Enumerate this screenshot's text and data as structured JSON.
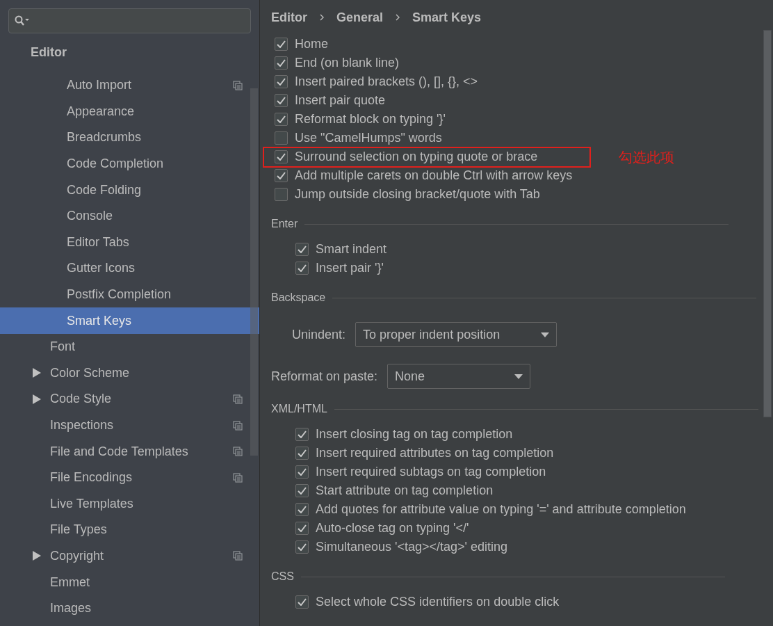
{
  "sidebar": {
    "header": "Editor",
    "items": [
      {
        "kind": "page",
        "label": "Auto Import",
        "selected": false,
        "project_level": true,
        "sub": true
      },
      {
        "kind": "page",
        "label": "Appearance",
        "selected": false,
        "project_level": false,
        "sub": true
      },
      {
        "kind": "page",
        "label": "Breadcrumbs",
        "selected": false,
        "project_level": false,
        "sub": true
      },
      {
        "kind": "page",
        "label": "Code Completion",
        "selected": false,
        "project_level": false,
        "sub": true
      },
      {
        "kind": "page",
        "label": "Code Folding",
        "selected": false,
        "project_level": false,
        "sub": true
      },
      {
        "kind": "page",
        "label": "Console",
        "selected": false,
        "project_level": false,
        "sub": true
      },
      {
        "kind": "page",
        "label": "Editor Tabs",
        "selected": false,
        "project_level": false,
        "sub": true
      },
      {
        "kind": "page",
        "label": "Gutter Icons",
        "selected": false,
        "project_level": false,
        "sub": true
      },
      {
        "kind": "page",
        "label": "Postfix Completion",
        "selected": false,
        "project_level": false,
        "sub": true
      },
      {
        "kind": "page",
        "label": "Smart Keys",
        "selected": true,
        "project_level": false,
        "sub": true
      },
      {
        "kind": "page",
        "label": "Font",
        "selected": false,
        "project_level": false,
        "sub": false
      },
      {
        "kind": "group",
        "label": "Color Scheme",
        "selected": false,
        "expanded": false,
        "project_level": false,
        "sub": false
      },
      {
        "kind": "group",
        "label": "Code Style",
        "selected": false,
        "expanded": false,
        "project_level": true,
        "sub": false
      },
      {
        "kind": "page",
        "label": "Inspections",
        "selected": false,
        "project_level": true,
        "sub": false
      },
      {
        "kind": "page",
        "label": "File and Code Templates",
        "selected": false,
        "project_level": true,
        "sub": false
      },
      {
        "kind": "page",
        "label": "File Encodings",
        "selected": false,
        "project_level": true,
        "sub": false
      },
      {
        "kind": "page",
        "label": "Live Templates",
        "selected": false,
        "project_level": false,
        "sub": false
      },
      {
        "kind": "page",
        "label": "File Types",
        "selected": false,
        "project_level": false,
        "sub": false
      },
      {
        "kind": "group",
        "label": "Copyright",
        "selected": false,
        "expanded": false,
        "project_level": true,
        "sub": false
      },
      {
        "kind": "page",
        "label": "Emmet",
        "selected": false,
        "project_level": false,
        "sub": false
      },
      {
        "kind": "page",
        "label": "Images",
        "selected": false,
        "project_level": false,
        "sub": false
      }
    ]
  },
  "breadcrumb": [
    "Editor",
    "General",
    "Smart Keys"
  ],
  "content": [
    {
      "kind": "group",
      "items": [
        {
          "kind": "check",
          "label": "Home",
          "checked": true,
          "highlighted": false
        },
        {
          "kind": "check",
          "label": "End (on blank line)",
          "checked": true,
          "highlighted": false
        },
        {
          "kind": "check",
          "label": "Insert paired brackets (), [], {}, <>",
          "checked": true,
          "highlighted": false
        },
        {
          "kind": "check",
          "label": "Insert pair quote",
          "checked": true,
          "highlighted": false
        },
        {
          "kind": "check",
          "label": "Reformat block on typing '}'",
          "checked": true,
          "highlighted": false
        },
        {
          "kind": "check",
          "label": "Use \"CamelHumps\" words",
          "checked": false,
          "highlighted": false
        },
        {
          "kind": "check",
          "label": "Surround selection on typing quote or brace",
          "checked": true,
          "highlighted": true,
          "annotation": "勾选此项"
        },
        {
          "kind": "check",
          "label": "Add multiple carets on double Ctrl with arrow keys",
          "checked": true,
          "highlighted": false
        },
        {
          "kind": "check",
          "label": "Jump outside closing bracket/quote with Tab",
          "checked": false,
          "highlighted": false
        }
      ]
    },
    {
      "kind": "section",
      "title": "Enter",
      "items": [
        {
          "kind": "check",
          "label": "Smart indent",
          "checked": true,
          "highlighted": false
        },
        {
          "kind": "check",
          "label": "Insert pair '}'",
          "checked": true,
          "highlighted": false
        }
      ]
    },
    {
      "kind": "section",
      "title": "Backspace",
      "items": [
        {
          "kind": "dropdown",
          "label": "Unindent:",
          "value": "To proper indent position"
        }
      ]
    },
    {
      "kind": "dropdown",
      "label": "Reformat on paste:",
      "value": "None"
    },
    {
      "kind": "section",
      "title": "XML/HTML",
      "items": [
        {
          "kind": "check",
          "label": "Insert closing tag on tag completion",
          "checked": true,
          "highlighted": false
        },
        {
          "kind": "check",
          "label": "Insert required attributes on tag completion",
          "checked": true,
          "highlighted": false
        },
        {
          "kind": "check",
          "label": "Insert required subtags on tag completion",
          "checked": true,
          "highlighted": false
        },
        {
          "kind": "check",
          "label": "Start attribute on tag completion",
          "checked": true,
          "highlighted": false
        },
        {
          "kind": "check",
          "label": "Add quotes for attribute value on typing '=' and attribute completion",
          "checked": true,
          "highlighted": false
        },
        {
          "kind": "check",
          "label": "Auto-close tag on typing '</'",
          "checked": true,
          "highlighted": false
        },
        {
          "kind": "check",
          "label": "Simultaneous '<tag></tag>' editing",
          "checked": true,
          "highlighted": false
        }
      ]
    },
    {
      "kind": "section",
      "title": "CSS",
      "items": [
        {
          "kind": "check",
          "label": "Select whole CSS identifiers on double click",
          "checked": true,
          "highlighted": false
        }
      ]
    }
  ]
}
